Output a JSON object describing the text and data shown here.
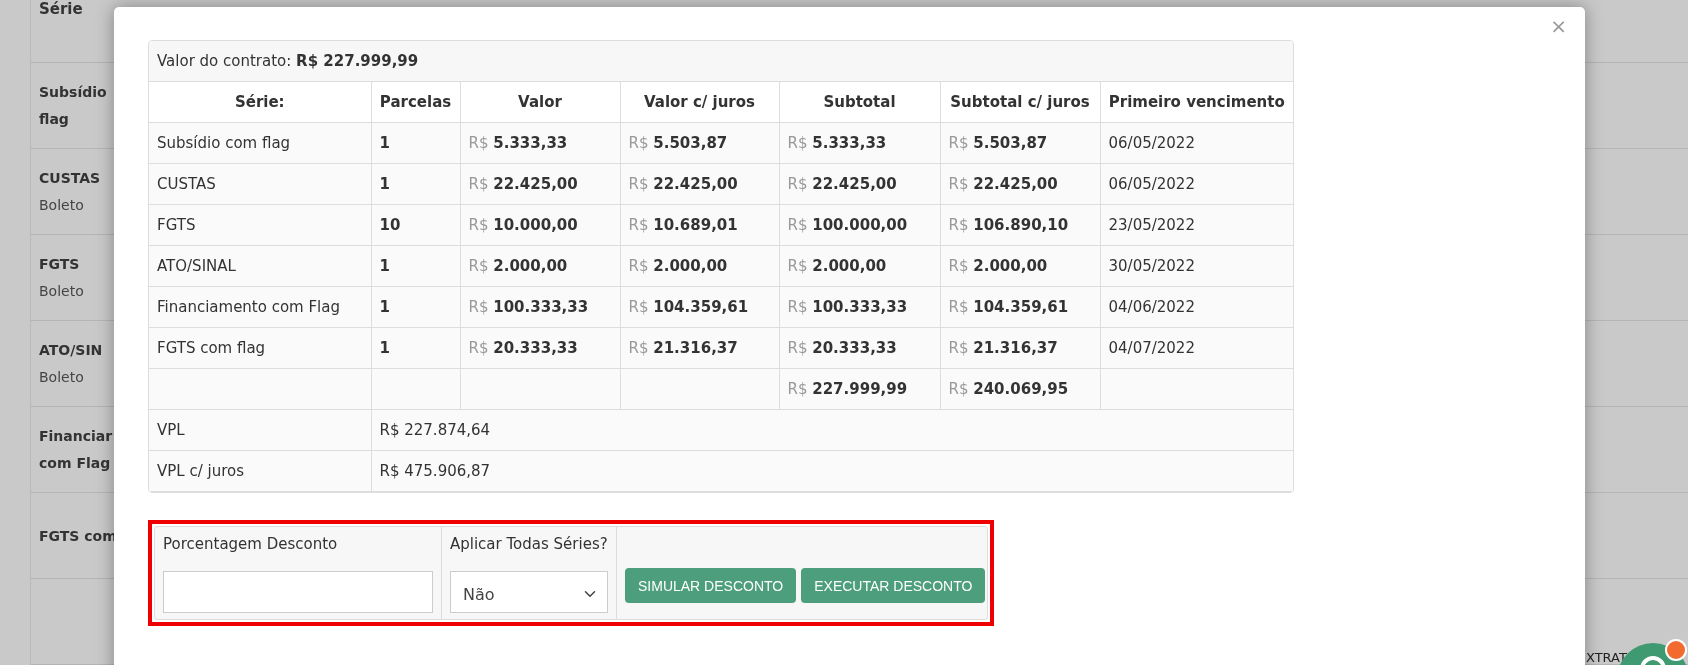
{
  "background": {
    "header": "Série",
    "rows": [
      {
        "lines": [
          "Subsídio",
          "flag"
        ]
      },
      {
        "lines": [
          "CUSTAS"
        ],
        "subtitle": "Boleto"
      },
      {
        "lines": [
          "FGTS"
        ],
        "subtitle": "Boleto"
      },
      {
        "lines": [
          "ATO/SIN"
        ],
        "subtitle": "Boleto"
      },
      {
        "lines": [
          "Financiar",
          "com Flag"
        ]
      },
      {
        "lines": [
          "FGTS com"
        ]
      },
      {
        "lines": []
      }
    ],
    "corner_text": "XTRAT"
  },
  "modal": {
    "close": "×",
    "contract_label": "Valor do contrato:",
    "contract_value": "R$ 227.999,99",
    "columns": [
      "Série:",
      "Parcelas",
      "Valor",
      "Valor c/ juros",
      "Subtotal",
      "Subtotal c/ juros",
      "Primeiro vencimento"
    ],
    "rows": [
      {
        "serie": "Subsídio com flag",
        "parcelas": "1",
        "valor": "R$ 5.333,33",
        "valor_juros": "R$ 5.503,87",
        "subtotal": "R$ 5.333,33",
        "subtotal_juros": "R$ 5.503,87",
        "vencimento": "06/05/2022"
      },
      {
        "serie": "CUSTAS",
        "parcelas": "1",
        "valor": "R$ 22.425,00",
        "valor_juros": "R$ 22.425,00",
        "subtotal": "R$ 22.425,00",
        "subtotal_juros": "R$ 22.425,00",
        "vencimento": "06/05/2022"
      },
      {
        "serie": "FGTS",
        "parcelas": "10",
        "valor": "R$ 10.000,00",
        "valor_juros": "R$ 10.689,01",
        "subtotal": "R$ 100.000,00",
        "subtotal_juros": "R$ 106.890,10",
        "vencimento": "23/05/2022"
      },
      {
        "serie": "ATO/SINAL",
        "parcelas": "1",
        "valor": "R$ 2.000,00",
        "valor_juros": "R$ 2.000,00",
        "subtotal": "R$ 2.000,00",
        "subtotal_juros": "R$ 2.000,00",
        "vencimento": "30/05/2022"
      },
      {
        "serie": "Financiamento com Flag",
        "parcelas": "1",
        "valor": "R$ 100.333,33",
        "valor_juros": "R$ 104.359,61",
        "subtotal": "R$ 100.333,33",
        "subtotal_juros": "R$ 104.359,61",
        "vencimento": "04/06/2022"
      },
      {
        "serie": "FGTS com flag",
        "parcelas": "1",
        "valor": "R$ 20.333,33",
        "valor_juros": "R$ 21.316,37",
        "subtotal": "R$ 20.333,33",
        "subtotal_juros": "R$ 21.316,37",
        "vencimento": "04/07/2022"
      }
    ],
    "totals": {
      "subtotal": "R$ 227.999,99",
      "subtotal_juros": "R$ 240.069,95"
    },
    "summary": [
      {
        "label": "VPL",
        "value": "R$ 227.874,64"
      },
      {
        "label": "VPL c/ juros",
        "value": "R$ 475.906,87"
      }
    ],
    "form": {
      "discount_label": "Porcentagem Desconto",
      "apply_label": "Aplicar Todas Séries?",
      "apply_value": "Não",
      "highlighted": true,
      "buttons": [
        "SIMULAR DESCONTO",
        "EXECUTAR DESCONTO"
      ]
    }
  }
}
